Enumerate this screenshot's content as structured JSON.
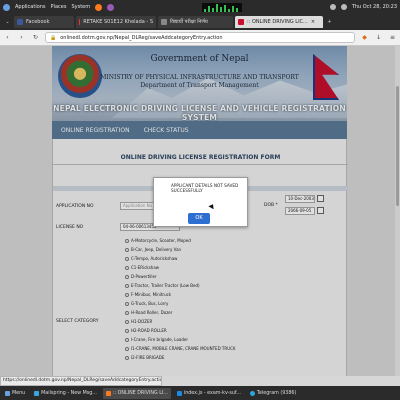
{
  "system_panel": {
    "menus": [
      "Applications",
      "Places",
      "System"
    ],
    "clock": "Thu Oct 28, 20:23"
  },
  "browser": {
    "tabs": [
      {
        "label": "Facebook",
        "active": false
      },
      {
        "label": "RETAKE S01E12 Khelada - S",
        "active": false
      },
      {
        "label": "विद्यार्थी परीक्षा निर्णय",
        "active": false
      },
      {
        "label": ":: ONLINE DRIVING LIC...",
        "active": true
      }
    ],
    "url": "onlinedl.dotm.gov.np/Nepal_DLReg/saveAddcategoryEntry.action",
    "status_link": "https://onlinedl.dotm.gov.np/Nepal_DLReg/saveAddcategoryEntry.action#"
  },
  "banner": {
    "line1": "Government of Nepal",
    "line2": "MINISTRY OF PHYSICAL INFRASTRUCTURE AND TRANSPORT",
    "line3": "Department of Transport Management",
    "line4": "NEPAL ELECTRONIC DRIVING LICENSE AND VEHICLE REGISTRATION SYSTEM"
  },
  "nav": {
    "online_registration": "ONLINE REGISTRATION",
    "check_status": "CHECK STATUS"
  },
  "form": {
    "title": "ONLINE DRIVING LICENSE REGISTRATION FORM",
    "application_no_label": "APPLICATION NO",
    "application_no_placeholder": "Application No",
    "license_no_label": "LICENSE NO",
    "license_no_value": "04-06-00613456",
    "dob_label": "DOB *",
    "dob_bs": "10-Dec-2003",
    "dob_ad": "2066-09-05",
    "category_label": "SELECT CATEGORY",
    "categories": [
      "A-Motorcycle, Scooter, Moped",
      "B-Car, Jeep, Delivery Van",
      "C-Tempo, Autorickshaw",
      "C1-ERickshaw",
      "D-Powertiller",
      "E-Tractor, Trailer Tractor (Low Bed)",
      "F-Minibus, Minitruck",
      "G-Truck, Bus, Lorry",
      "H-Road Roller, Dozer",
      "H1-DOZER",
      "H2-ROAD ROLLER",
      "I-Crane, Fire brigade, Loader",
      "I1-CRANE, MOBILE CRANE, CRANE MOUNTED TRUCK",
      "I2-FIRE BRIGADE"
    ]
  },
  "dialog": {
    "message": "APPLICANT DETAILS NOT SAVED SUCCESSFULLY",
    "ok": "OK"
  },
  "taskbar": {
    "items": [
      {
        "label": "Menu",
        "active": false
      },
      {
        "label": "Mailspring - New Msg...",
        "active": false
      },
      {
        "label": ":: ONLINE DRIVING LI...",
        "active": true
      },
      {
        "label": "index.js - exam-kv-suf...",
        "active": false
      },
      {
        "label": "Telegram (9386)",
        "active": false
      }
    ]
  },
  "colors": {
    "banner_bar": "#5b7a98",
    "title_text": "#2e4766",
    "ok_button": "#2d6fd0"
  }
}
